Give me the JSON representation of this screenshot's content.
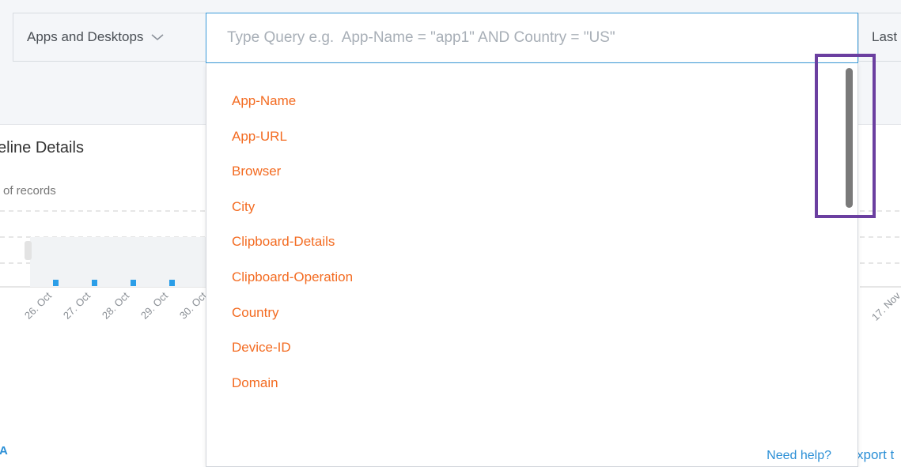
{
  "toolbar": {
    "app_selector_label": "Apps and Desktops",
    "search_placeholder": "Type Query e.g.  App-Name = \"app1\" AND Country = \"US\"",
    "time_range_label": "Last"
  },
  "timeline": {
    "title": "eline Details",
    "y_axis_label": "of records",
    "x_ticks": [
      "26. Oct",
      "27. Oct",
      "28. Oct",
      "29. Oct",
      "30. Oct",
      "17. Nov"
    ]
  },
  "query_suggestions": {
    "items": [
      "App-Name",
      "App-URL",
      "Browser",
      "City",
      "Clipboard-Details",
      "Clipboard-Operation",
      "Country",
      "Device-ID",
      "Domain"
    ],
    "help_link": "Need help?"
  },
  "footer": {
    "export_label": "xport t",
    "legend_fragment": "A"
  },
  "colors": {
    "suggestion": "#f36b21",
    "link": "#2b8fd6",
    "focus_border": "#3a9ad9",
    "highlight": "#6b3fa0",
    "data_points": "#2b9ee8"
  }
}
